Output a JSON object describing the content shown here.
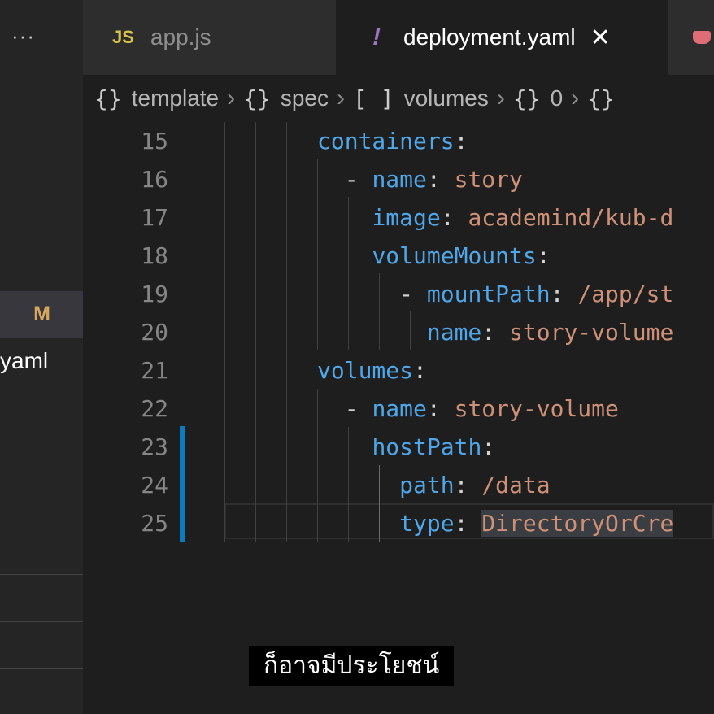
{
  "sidebar": {
    "more_icon": "ellipsis-icon",
    "more_glyph": "···",
    "modified_badge": "M",
    "file_fragment": "yaml"
  },
  "tabs": [
    {
      "icon_text": "JS",
      "label": "app.js",
      "active": false
    },
    {
      "icon_text": "!",
      "label": "deployment.yaml",
      "active": true,
      "close_glyph": "✕"
    },
    {
      "icon": "docker-icon",
      "label": "",
      "active": false
    }
  ],
  "breadcrumb": [
    {
      "icon": "{}",
      "label": "template"
    },
    {
      "icon": "{}",
      "label": "spec"
    },
    {
      "icon": "[ ]",
      "label": "volumes"
    },
    {
      "icon": "{}",
      "label": "0"
    },
    {
      "icon": "{}",
      "label": ""
    }
  ],
  "code_lines": [
    {
      "num": "15",
      "indent": "",
      "dash": "",
      "key": "containers",
      "colon": ":",
      "value": ""
    },
    {
      "num": "16",
      "indent": "  ",
      "dash": "- ",
      "key": "name",
      "colon": ": ",
      "value": "story"
    },
    {
      "num": "17",
      "indent": "    ",
      "dash": "",
      "key": "image",
      "colon": ": ",
      "value": "academind/kub-d"
    },
    {
      "num": "18",
      "indent": "    ",
      "dash": "",
      "key": "volumeMounts",
      "colon": ":",
      "value": ""
    },
    {
      "num": "19",
      "indent": "      ",
      "dash": "- ",
      "key": "mountPath",
      "colon": ": ",
      "value": "/app/st"
    },
    {
      "num": "20",
      "indent": "        ",
      "dash": "",
      "key": "name",
      "colon": ": ",
      "value": "story-volume"
    },
    {
      "num": "21",
      "indent": "",
      "dash": "",
      "key": "volumes",
      "colon": ":",
      "value": ""
    },
    {
      "num": "22",
      "indent": "  ",
      "dash": "- ",
      "key": "name",
      "colon": ": ",
      "value": "story-volume"
    },
    {
      "num": "23",
      "indent": "    ",
      "dash": "",
      "key": "hostPath",
      "colon": ":",
      "value": ""
    },
    {
      "num": "24",
      "indent": "      ",
      "dash": "",
      "key": "path",
      "colon": ": ",
      "value": "/data"
    },
    {
      "num": "25",
      "indent": "      ",
      "dash": "",
      "key": "type",
      "colon": ": ",
      "value": "DirectoryOrCre"
    }
  ],
  "subtitle": "ก็อาจมีประโยชน์",
  "colors": {
    "key": "#4fa6e8",
    "value": "#ce9178",
    "line_number": "#858585",
    "gutter_modified": "#0c7bbd",
    "modified_badge": "#d7a95f"
  }
}
